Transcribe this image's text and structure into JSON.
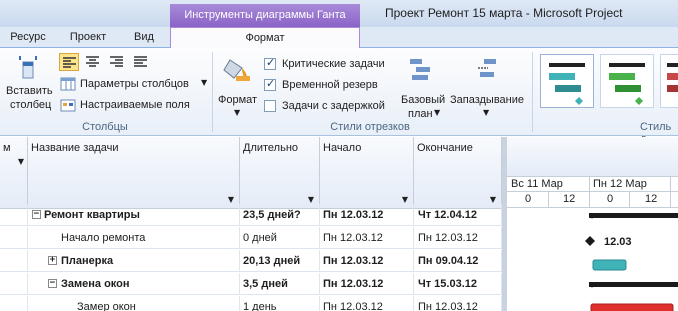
{
  "titlebar": {
    "tools_context": "Инструменты диаграммы Ганта",
    "window_title": "Проект Ремонт 15 марта  -  Microsoft Project"
  },
  "tabs": [
    {
      "label": "Ресурс"
    },
    {
      "label": "Проект"
    },
    {
      "label": "Вид"
    },
    {
      "label": "Формат"
    }
  ],
  "ribbon": {
    "columns_group": {
      "label": "Столбцы",
      "insert_column_line1": "Вставить",
      "insert_column_line2": "столбец",
      "column_settings": "Параметры столбцов",
      "custom_fields": "Настраиваемые поля"
    },
    "bar_styles_group": {
      "label": "Стили отрезков",
      "format": "Формат",
      "critical_tasks": "Критические задачи",
      "slack": "Временной резерв",
      "late_tasks": "Задачи с задержкой",
      "baseline_line1": "Базовый",
      "baseline_line2": "план",
      "slippage": "Запаздывание",
      "critical_checked": true,
      "slack_checked": true,
      "late_checked": false
    },
    "gantt_styles_group": {
      "label": "Стиль д"
    }
  },
  "grid": {
    "columns": [
      "м",
      "Название задачи",
      "Длительно",
      "Начало",
      "Окончание"
    ],
    "rows": [
      {
        "name": "Ремонт квартиры",
        "duration": "23,5 дней?",
        "start": "Пн 12.03.12",
        "finish": "Чт 12.04.12",
        "level": 0,
        "summary": true,
        "toggle": "−"
      },
      {
        "name": "Начало ремонта",
        "duration": "0 дней",
        "start": "Пн 12.03.12",
        "finish": "Пн 12.03.12",
        "level": 1,
        "summary": false,
        "toggle": ""
      },
      {
        "name": "Планерка",
        "duration": "20,13 дней",
        "start": "Пн 12.03.12",
        "finish": "Пн 09.04.12",
        "level": 1,
        "summary": true,
        "toggle": "+"
      },
      {
        "name": "Замена окон",
        "duration": "3,5 дней",
        "start": "Пн 12.03.12",
        "finish": "Чт 15.03.12",
        "level": 1,
        "summary": true,
        "toggle": "−"
      },
      {
        "name": "Замер окон",
        "duration": "1 день",
        "start": "Пн 12.03.12",
        "finish": "Пн 12.03.12",
        "level": 2,
        "summary": false,
        "toggle": ""
      }
    ]
  },
  "gantt": {
    "week1": "Вс 11 Мар",
    "week2": "Пн 12 Мар",
    "hours": [
      "0",
      "12",
      "0",
      "12"
    ],
    "milestone_label": "12.03",
    "colors": {
      "summary": "#1a1a1a",
      "task": "#3fb3b8",
      "critical": "#e0302e"
    }
  }
}
